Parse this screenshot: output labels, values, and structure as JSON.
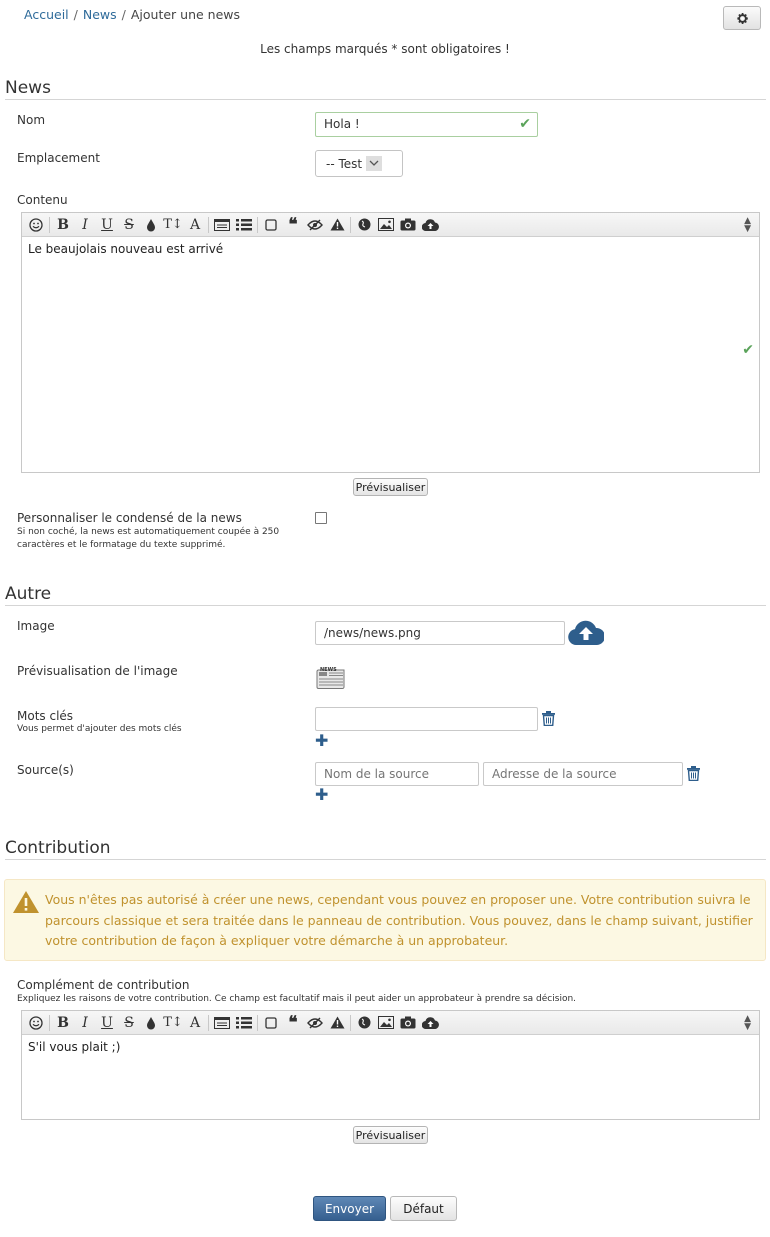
{
  "breadcrumb": {
    "home": "Accueil",
    "section": "News",
    "current": "Ajouter une news",
    "separator": "/"
  },
  "required_note": "Les champs marqués * sont obligatoires !",
  "sections": {
    "news": "News",
    "autre": "Autre",
    "contribution": "Contribution"
  },
  "fields": {
    "nom_label": "Nom",
    "nom_value": "Hola !",
    "emplacement_label": "Emplacement",
    "emplacement_value": "-- Test",
    "contenu_label": "Contenu",
    "contenu_text": "Le beaujolais nouveau est arrivé",
    "preview_label": "Prévisualiser",
    "condense_label": "Personnaliser le condensé de la news",
    "condense_hint_1": "Si non coché, la news est automatiquement coupée à 250",
    "condense_hint_2": "caractères et le formatage du texte supprimé.",
    "image_label": "Image",
    "image_value": "/news/news.png",
    "image_preview_label": "Prévisualisation de l'image",
    "news_thumb_text": "NEWS",
    "keywords_label": "Mots clés",
    "keywords_hint": "Vous permet d'ajouter des mots clés",
    "keywords_value": "",
    "sources_label": "Source(s)",
    "source_name_placeholder": "Nom de la source",
    "source_url_placeholder": "Adresse de la source"
  },
  "contribution": {
    "warning": "Vous n'êtes pas autorisé à créer une news, cependant vous pouvez en proposer une. Votre contribution suivra le parcours classique et sera traitée dans le panneau de contribution. Vous pouvez, dans le champ suivant, justifier votre contribution de façon à expliquer votre démarche à un approbateur.",
    "complement_label": "Complément de contribution",
    "complement_hint": "Expliquez les raisons de votre contribution. Ce champ est facultatif mais il peut aider un approbateur à prendre sa décision.",
    "complement_text": "S'il vous plait ;)",
    "preview_label": "Prévisualiser"
  },
  "toolbar_icons": [
    "smiley-icon",
    "bold-icon",
    "italic-icon",
    "underline-icon",
    "strikethrough-icon",
    "color-drop-icon",
    "font-size-icon",
    "font-icon",
    "code-block-icon",
    "list-icon",
    "checkbox-icon",
    "quote-icon",
    "spoiler-icon",
    "warning-icon",
    "globe-icon",
    "image-icon",
    "camera-icon",
    "upload-cloud-icon"
  ],
  "actions": {
    "submit": "Envoyer",
    "default": "Défaut"
  },
  "colors": {
    "link": "#2f6b9a",
    "primary": "#355f8f",
    "warning_text": "#c0922e",
    "warning_bg": "#fcf8e3",
    "valid": "#5aa35a"
  }
}
